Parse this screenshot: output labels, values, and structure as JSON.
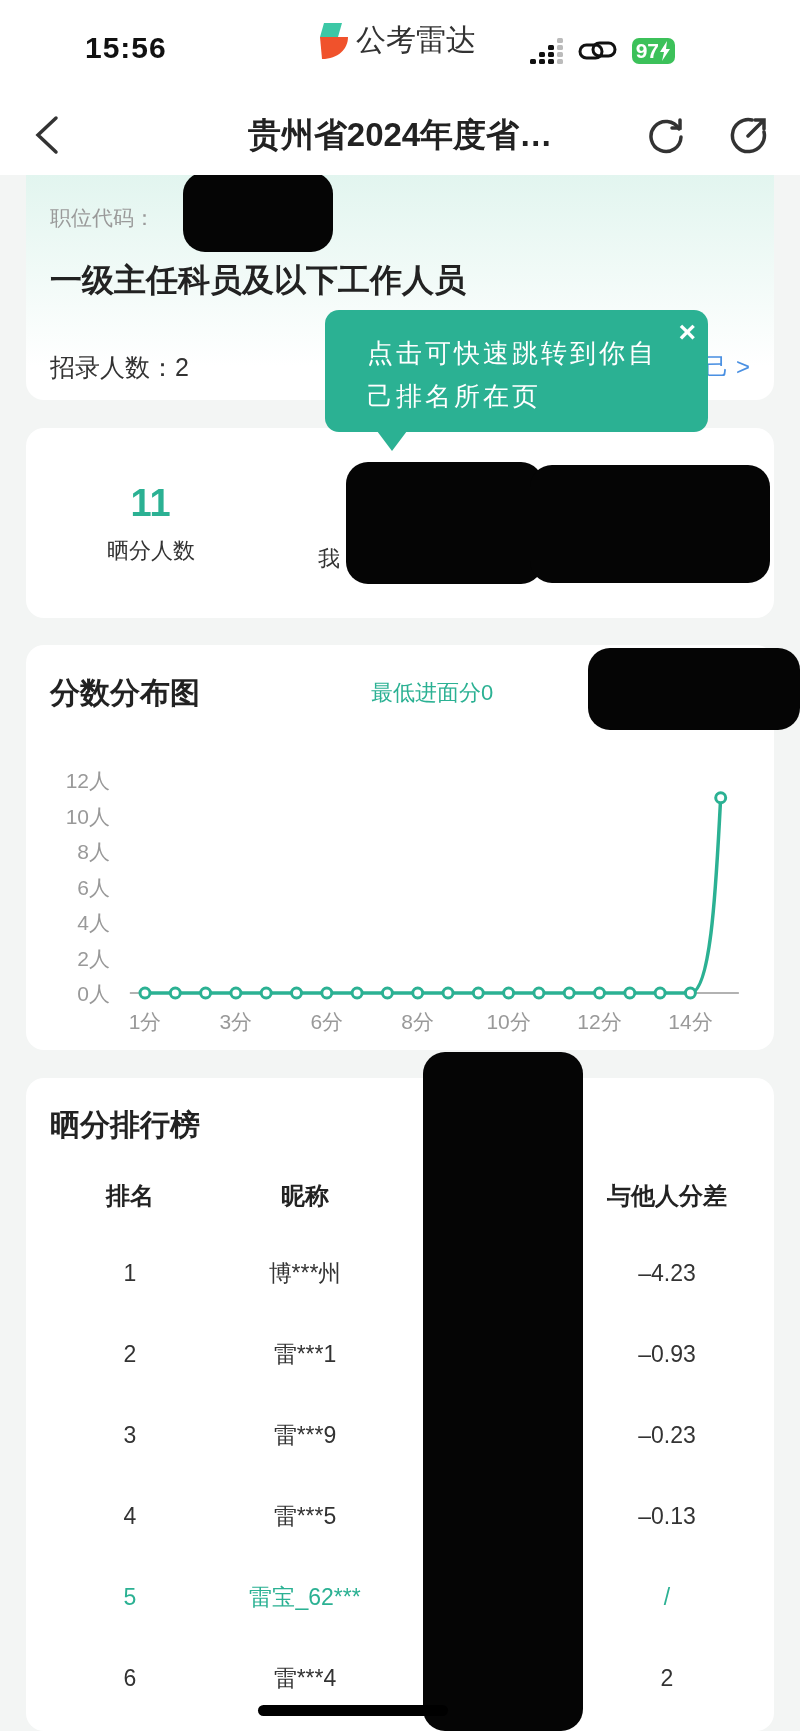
{
  "status_bar": {
    "time": "15:56",
    "app_name": "公考雷达",
    "battery": "97"
  },
  "nav": {
    "title": "贵州省2024年度省…"
  },
  "position_card": {
    "code_label": "职位代码：",
    "title": "一级主任科员及以下工作人员",
    "recruit": "招录人数：2",
    "link": "己 >"
  },
  "tooltip": {
    "text": "点击可快速跳转到你自己排名所在页",
    "close": "×"
  },
  "stats": [
    {
      "value": "11",
      "label": "晒分人数"
    },
    {
      "label": "我"
    }
  ],
  "distribution": {
    "title": "分数分布图",
    "legend": "最低进面分0",
    "chart_data": {
      "type": "line",
      "categories": [
        "1分",
        null,
        null,
        "3分",
        null,
        null,
        "6分",
        null,
        null,
        "8分",
        null,
        null,
        "10分",
        null,
        null,
        "12分",
        null,
        null,
        "14分",
        null
      ],
      "series": [
        {
          "color": "#2bb193",
          "marker": "circle",
          "values": [
            0,
            0,
            0,
            0,
            0,
            0,
            0,
            0,
            0,
            0,
            0,
            0,
            0,
            0,
            0,
            0,
            0,
            0,
            0,
            11
          ]
        }
      ],
      "ylim": [
        0,
        12
      ],
      "yticks": [
        {
          "value": 0,
          "label": "0人"
        },
        {
          "value": 2,
          "label": "2人"
        },
        {
          "value": 4,
          "label": "4人"
        },
        {
          "value": 6,
          "label": "6人"
        },
        {
          "value": 8,
          "label": "8人"
        },
        {
          "value": 10,
          "label": "10人"
        },
        {
          "value": 12,
          "label": "12人"
        }
      ]
    }
  },
  "ranking": {
    "title": "晒分排行榜",
    "columns": [
      "排名",
      "昵称",
      "与他人分差"
    ],
    "rows": [
      {
        "rank": "1",
        "nickname": "博***州",
        "diff": "–4.23",
        "highlighted": false
      },
      {
        "rank": "2",
        "nickname": "雷***1",
        "diff": "–0.93",
        "highlighted": false
      },
      {
        "rank": "3",
        "nickname": "雷***9",
        "diff": "–0.23",
        "highlighted": false
      },
      {
        "rank": "4",
        "nickname": "雷***5",
        "diff": "–0.13",
        "highlighted": false
      },
      {
        "rank": "5",
        "nickname": "雷宝_62***",
        "diff": "/",
        "highlighted": true
      },
      {
        "rank": "6",
        "nickname": "雷***4",
        "diff": "2",
        "highlighted": false
      }
    ]
  }
}
